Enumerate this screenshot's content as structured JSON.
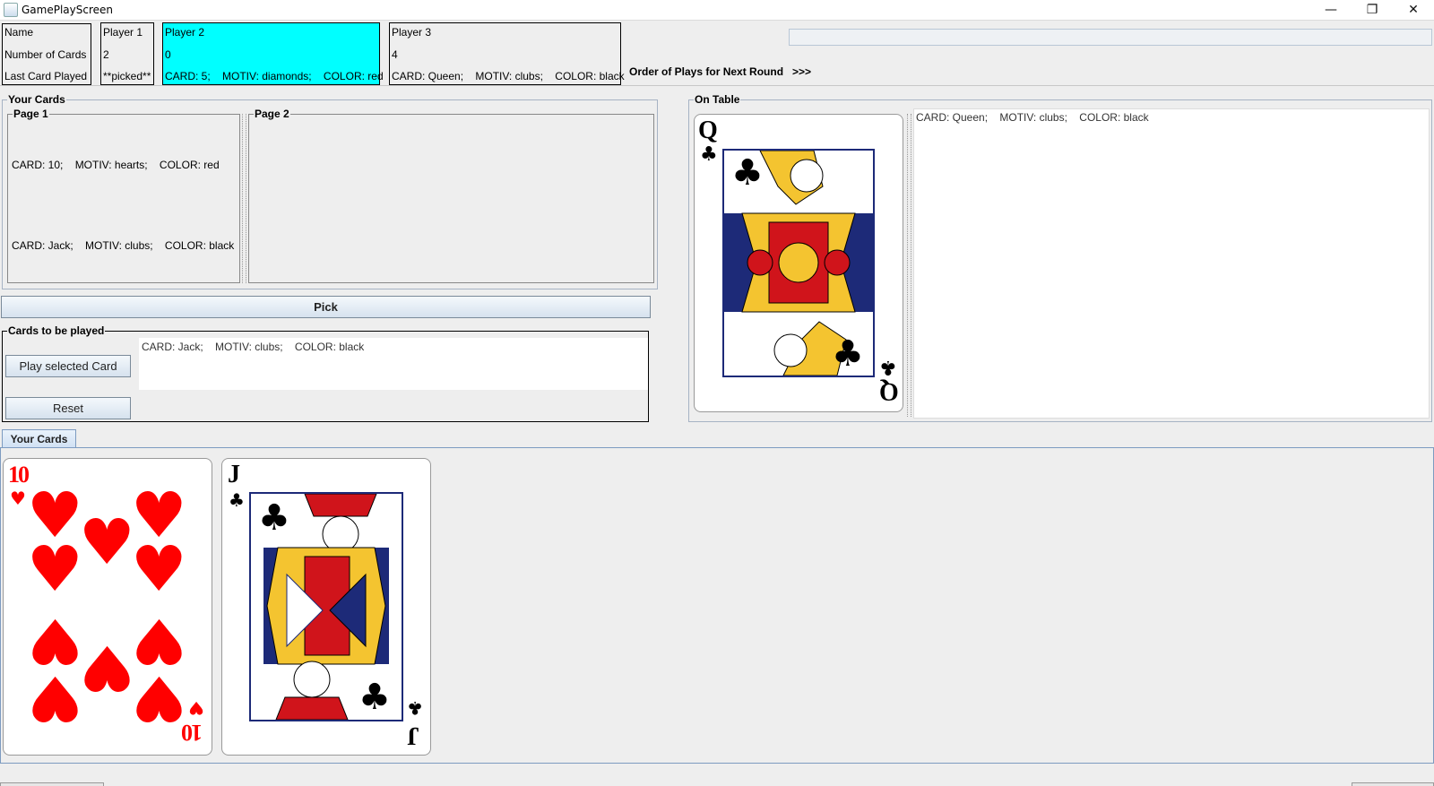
{
  "window": {
    "title": "GamePlayScreen",
    "minimize": "—",
    "restore": "❐",
    "close": "✕"
  },
  "players_table": {
    "row_labels": [
      "Name",
      "Number of Cards",
      "Last Card Played"
    ],
    "players": [
      {
        "name": "Player 1",
        "cards": "2",
        "last": "**picked**"
      },
      {
        "name": "Player 2",
        "cards": "0",
        "last": "CARD: 5;    MOTIV: diamonds;    COLOR: red"
      },
      {
        "name": "Player 3",
        "cards": "4",
        "last": "CARD: Queen;    MOTIV: clubs;    COLOR: black"
      }
    ],
    "highlight_color": "#00ffff"
  },
  "order_label": "Order of Plays for Next Round   >>>",
  "your_cards": {
    "title": "Your Cards",
    "page1_title": "Page 1",
    "page2_title": "Page 2",
    "page1_items": [
      "CARD: 10;    MOTIV: hearts;    COLOR: red",
      "CARD: Jack;    MOTIV: clubs;    COLOR: black"
    ]
  },
  "pick_button": "Pick",
  "to_play": {
    "title": "Cards to be played",
    "play_button": "Play selected Card",
    "reset_button": "Reset",
    "list_text": "CARD: Jack;    MOTIV: clubs;    COLOR: black"
  },
  "on_table": {
    "title": "On Table",
    "card_rank": "Q",
    "card_suit": "♣",
    "text": "CARD: Queen;    MOTIV: clubs;    COLOR: black"
  },
  "bottom_tab": {
    "label": "Your Cards"
  },
  "hand_cards": [
    {
      "rank": "10",
      "suit": "♥",
      "color": "#ff0000"
    },
    {
      "rank": "J",
      "suit": "♣",
      "color": "#000000"
    }
  ]
}
